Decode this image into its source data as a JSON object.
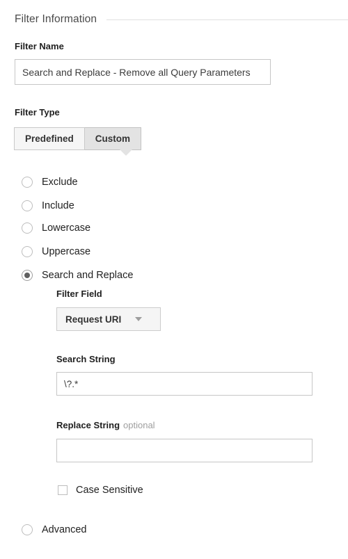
{
  "section": {
    "title": "Filter Information"
  },
  "filter_name": {
    "label": "Filter Name",
    "value": "Search and Replace - Remove all Query Parameters",
    "placeholder": ""
  },
  "filter_type": {
    "label": "Filter Type",
    "tabs": [
      {
        "label": "Predefined",
        "selected": false
      },
      {
        "label": "Custom",
        "selected": true
      }
    ]
  },
  "filter_options": [
    {
      "label": "Exclude",
      "selected": false
    },
    {
      "label": "Include",
      "selected": false
    },
    {
      "label": "Lowercase",
      "selected": false
    },
    {
      "label": "Uppercase",
      "selected": false
    },
    {
      "label": "Search and Replace",
      "selected": true
    },
    {
      "label": "Advanced",
      "selected": false
    }
  ],
  "filter_field": {
    "label": "Filter Field",
    "selected": "Request URI"
  },
  "search_string": {
    "label": "Search String",
    "value": "\\?.*",
    "placeholder": ""
  },
  "replace_string": {
    "label": "Replace String",
    "optional_tag": "optional",
    "value": "",
    "placeholder": ""
  },
  "case_sensitive": {
    "label": "Case Sensitive",
    "checked": false
  },
  "colors": {
    "text": "#212121",
    "muted": "#9e9e9e",
    "border": "#c6c6c6",
    "tab_selected_bg": "#e3e3e3",
    "tab_bg": "#f6f6f6",
    "rule": "#e0e0e0"
  }
}
